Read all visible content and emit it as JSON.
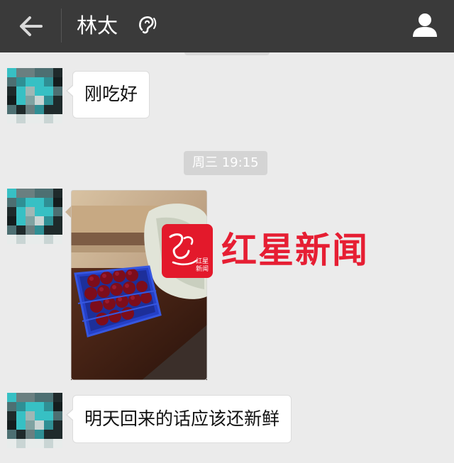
{
  "header": {
    "title": "林太",
    "back_icon": "arrow-left-icon",
    "audio_mode_icon": "ear-icon",
    "profile_icon": "person-icon"
  },
  "messages": [
    {
      "sender": "contact",
      "type": "text",
      "text": "刚吃好"
    },
    {
      "type": "timestamp",
      "text": "周三 19:15"
    },
    {
      "sender": "contact",
      "type": "image"
    },
    {
      "sender": "contact",
      "type": "text",
      "text": "明天回来的话应该还新鲜"
    }
  ],
  "watermark": {
    "text": "红星新闻",
    "logo_small_text": "红星新闻"
  },
  "colors": {
    "header_bg": "#3a3a3a",
    "chat_bg": "#ebebeb",
    "bubble_bg": "#ffffff",
    "timestamp_bg": "#d4d4d4",
    "watermark_red": "#e61e33"
  }
}
